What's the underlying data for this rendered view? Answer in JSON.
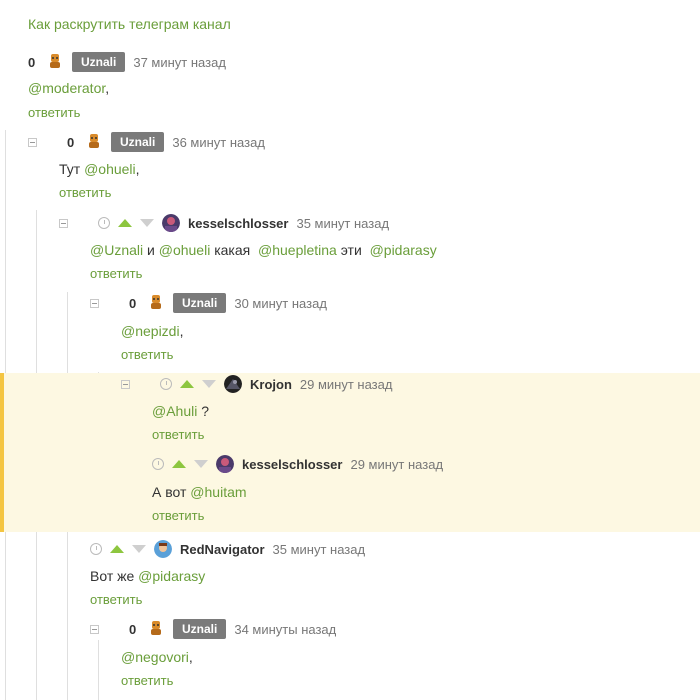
{
  "page_title": "Как раскрутить телеграм канал",
  "reply_label": "ответить",
  "comments": [
    {
      "rating": "0",
      "author": "Uznali",
      "time": "37 минут назад",
      "text": [
        {
          "m": "@moderator"
        },
        {
          "t": ","
        }
      ]
    },
    {
      "rating": "0",
      "author": "Uznali",
      "time": "36 минут назад",
      "text": [
        {
          "t": "Тут "
        },
        {
          "m": "@ohueli"
        },
        {
          "t": ","
        }
      ]
    },
    {
      "author": "kesselschlosser",
      "time": "35 минут назад",
      "text": [
        {
          "m": "@Uznali"
        },
        {
          "t": " и "
        },
        {
          "m": "@ohueli"
        },
        {
          "t": " какая  "
        },
        {
          "m": "@huepletina"
        },
        {
          "t": " эти  "
        },
        {
          "m": "@pidarasy"
        }
      ]
    },
    {
      "rating": "0",
      "author": "Uznali",
      "time": "30 минут назад",
      "text": [
        {
          "m": "@nepizdi"
        },
        {
          "t": ","
        }
      ]
    },
    {
      "author": "Krojon",
      "time": "29 минут назад",
      "text": [
        {
          "m": "@Ahuli"
        },
        {
          "t": " ?"
        }
      ]
    },
    {
      "author": "kesselschlosser",
      "time": "29 минут назад",
      "text": [
        {
          "t": "А вот "
        },
        {
          "m": "@huitam"
        }
      ]
    },
    {
      "author": "RedNavigator",
      "time": "35 минут назад",
      "text": [
        {
          "t": "Вот же "
        },
        {
          "m": "@pidarasy"
        }
      ]
    },
    {
      "rating": "0",
      "author": "Uznali",
      "time": "34 минуты назад",
      "text": [
        {
          "m": "@negovori"
        },
        {
          "t": ","
        }
      ]
    }
  ],
  "colors": {
    "link": "#6a9e3a",
    "highlight_bg": "#fdf8e2",
    "highlight_border": "#f4c542",
    "badge_bg": "#7a7a7a",
    "upvote": "#8dc63f"
  }
}
